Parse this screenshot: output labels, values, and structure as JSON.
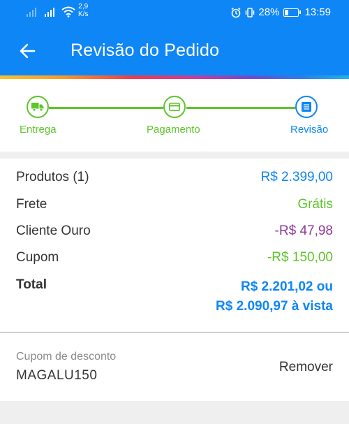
{
  "status_bar": {
    "net_speed_value": "2,9",
    "net_speed_unit": "K/s",
    "battery": "28%",
    "time": "13:59"
  },
  "app_bar": {
    "title": "Revisão do Pedido"
  },
  "stepper": {
    "steps": [
      {
        "label": "Entrega",
        "state": "done",
        "icon": "truck-icon"
      },
      {
        "label": "Pagamento",
        "state": "done",
        "icon": "card-icon"
      },
      {
        "label": "Revisão",
        "state": "active",
        "icon": "list-icon"
      }
    ]
  },
  "summary": {
    "rows": [
      {
        "label": "Produtos (1)",
        "value": "R$ 2.399,00",
        "color": "#0f86f5"
      },
      {
        "label": "Frete",
        "value": "Grátis",
        "color": "#5ec52a"
      },
      {
        "label": "Cliente Ouro",
        "value": "-R$ 47,98",
        "color": "#8e3a96"
      },
      {
        "label": "Cupom",
        "value": "-R$ 150,00",
        "color": "#5ec52a"
      }
    ],
    "total_label": "Total",
    "total_value_line1": "R$ 2.201,02 ou",
    "total_value_line2": "R$ 2.090,97 à vista"
  },
  "coupon": {
    "label": "Cupom de desconto",
    "code": "MAGALU150",
    "remove_label": "Remover"
  },
  "colors": {
    "primary": "#0f86f5",
    "success": "#5ec52a",
    "gold_client": "#8e3a96"
  }
}
